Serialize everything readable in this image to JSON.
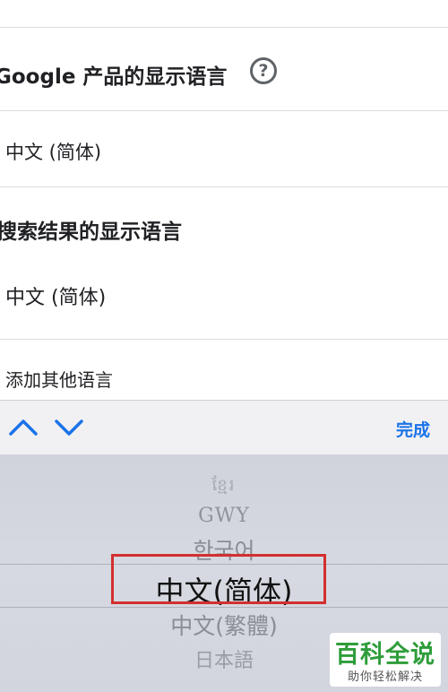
{
  "sections": {
    "product_language": {
      "heading": "Google 产品的显示语言",
      "value": "中文 (简体)"
    },
    "search_language": {
      "heading": "搜索结果的显示语言",
      "value": "中文 (简体)"
    },
    "add_language": "添加其他语言"
  },
  "toolbar": {
    "done_label": "完成"
  },
  "picker": {
    "items": [
      "ខ្មែរ",
      "GWY",
      "한국어",
      "中文(简体)",
      "中文(繁體)",
      "日本語"
    ],
    "selected": "中文(简体)"
  },
  "watermark": {
    "title": "百科全说",
    "subtitle": "助你轻松解决"
  },
  "colors": {
    "accent": "#1a73e8",
    "highlight": "#d32f2f",
    "watermark_green": "#2e9d3a"
  }
}
